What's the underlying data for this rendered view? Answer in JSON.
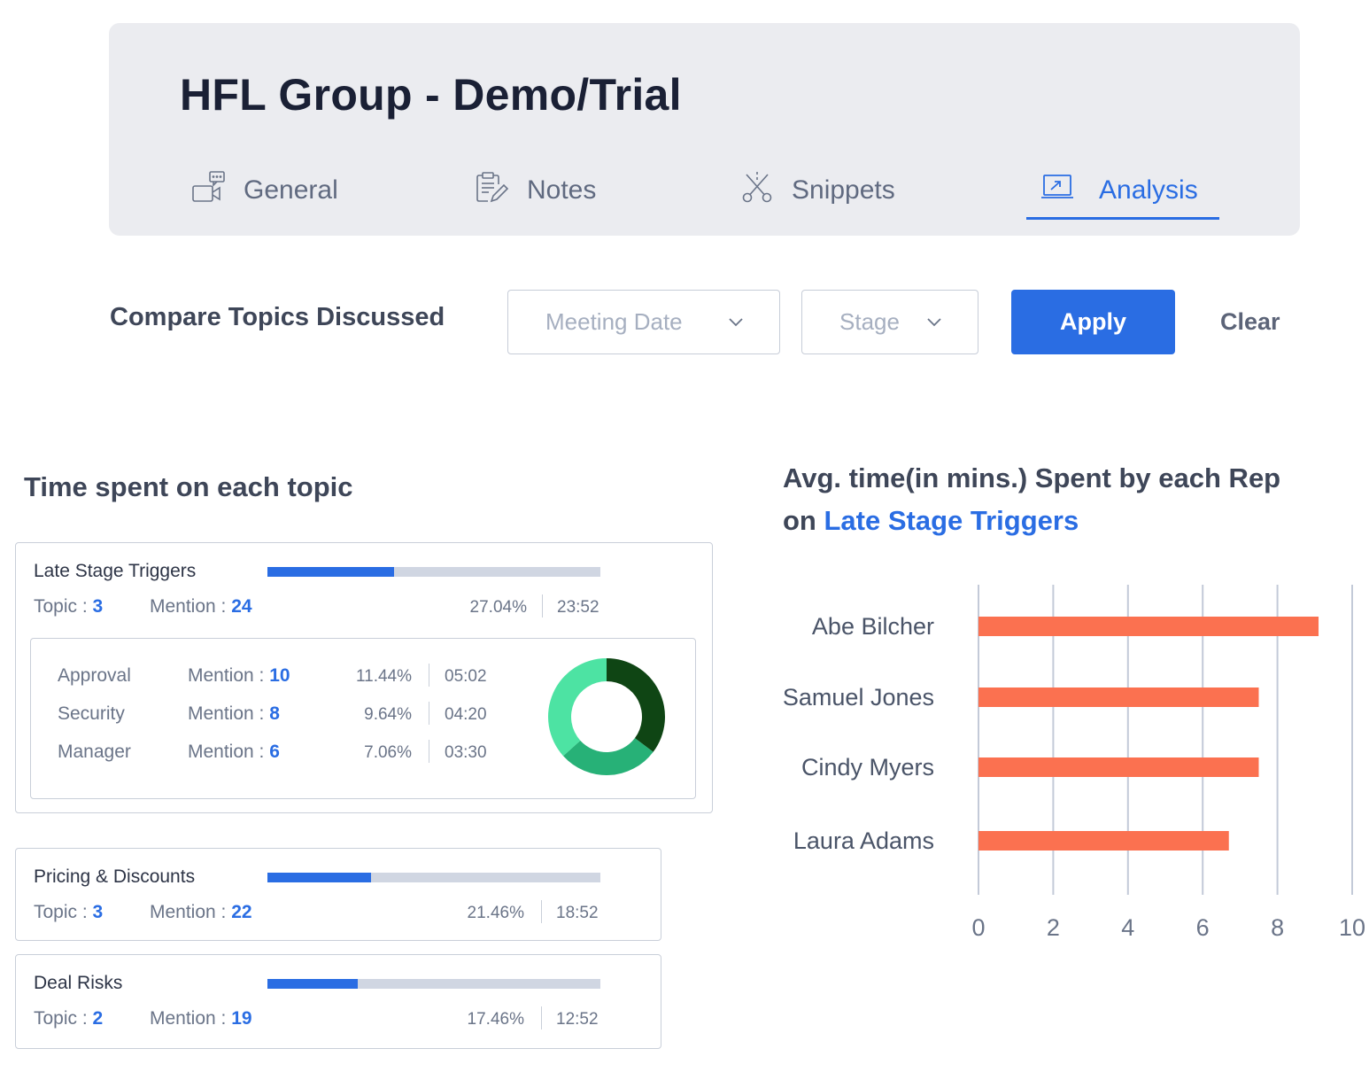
{
  "header": {
    "title": "HFL Group - Demo/Trial",
    "tabs": [
      {
        "label": "General",
        "icon": "video-chat-icon",
        "active": false
      },
      {
        "label": "Notes",
        "icon": "clipboard-edit-icon",
        "active": false
      },
      {
        "label": "Snippets",
        "icon": "scissors-icon",
        "active": false
      },
      {
        "label": "Analysis",
        "icon": "chart-monitor-icon",
        "active": true
      }
    ]
  },
  "filters": {
    "label": "Compare Topics Discussed",
    "meeting_date_placeholder": "Meeting Date",
    "stage_placeholder": "Stage",
    "apply_label": "Apply",
    "clear_label": "Clear"
  },
  "topics_section": {
    "title": "Time spent on each topic",
    "topic_prefix": "Topic : ",
    "mention_prefix": "Mention : ",
    "topics": [
      {
        "name": "Late Stage Triggers",
        "topic": "3",
        "mention": "24",
        "percent": "27.04%",
        "time": "23:52",
        "bar_fill_fraction": 0.38,
        "subtopics": [
          {
            "name": "Approval",
            "mention": "10",
            "percent": "11.44%",
            "time": "05:02"
          },
          {
            "name": "Security",
            "mention": "8",
            "percent": "9.64%",
            "time": "04:20"
          },
          {
            "name": "Manager",
            "mention": "6",
            "percent": "7.06%",
            "time": "03:30"
          }
        ]
      },
      {
        "name": "Pricing & Discounts",
        "topic": "3",
        "mention": "22",
        "percent": "21.46%",
        "time": "18:52",
        "bar_fill_fraction": 0.31
      },
      {
        "name": "Deal Risks",
        "topic": "2",
        "mention": "19",
        "percent": "17.46%",
        "time": "12:52",
        "bar_fill_fraction": 0.27
      }
    ],
    "donut": {
      "slices": [
        {
          "label": "Approval",
          "fraction": 0.353,
          "color": "#0f4514"
        },
        {
          "label": "Security",
          "fraction": 0.28,
          "color": "#27b177"
        },
        {
          "label": "Manager",
          "fraction": 0.367,
          "color": "#4de3a3"
        }
      ]
    }
  },
  "chart_title": {
    "prefix": "Avg. time(in mins.) Spent by each Rep",
    "on": "on ",
    "highlight": "Late Stage Triggers"
  },
  "colors": {
    "accent": "#2a6de3",
    "bar": "#fb7150",
    "grid": "#c3cad8"
  },
  "chart_data": {
    "type": "bar",
    "orientation": "horizontal",
    "title": "Avg. time(in mins.) Spent by each Rep on Late Stage Triggers",
    "categories": [
      "Abe Bilcher",
      "Samuel Jones",
      "Cindy Myers",
      "Laura Adams"
    ],
    "values": [
      9.1,
      7.5,
      7.5,
      6.7
    ],
    "xlabel": "",
    "ylabel": "",
    "xlim": [
      0,
      10
    ],
    "xticks": [
      "0",
      "2",
      "4",
      "6",
      "8",
      "10"
    ],
    "grid": true,
    "legend": "none"
  }
}
